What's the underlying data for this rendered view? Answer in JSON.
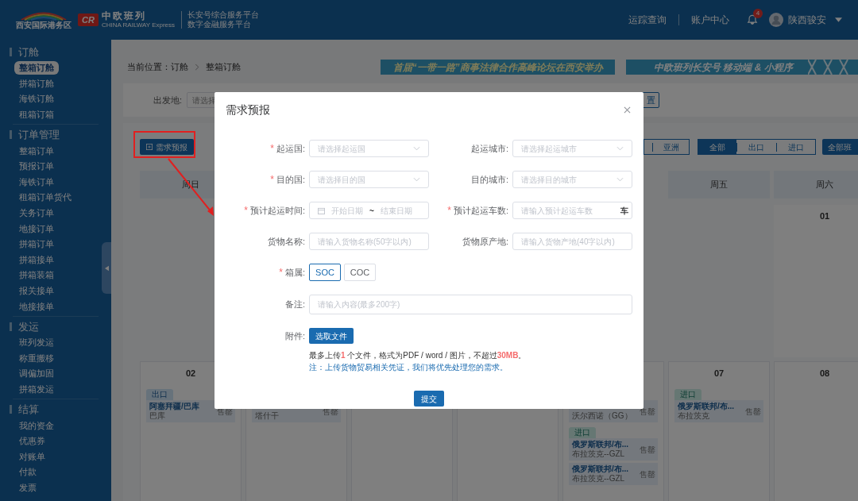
{
  "header": {
    "logo_text": "西安国际港务区",
    "brand_mark": "CR",
    "brand": "中欧班列",
    "brand_sub": "CHINA RAILWAY Express",
    "platform_lines": [
      "长安号综合服务平台",
      "数字金融服务平台"
    ],
    "nav": [
      "运踪查询",
      "账户中心"
    ],
    "notification_count": "4",
    "user": "陕西骏安"
  },
  "sidebar": {
    "groups": [
      {
        "title": "订舱",
        "items": [
          {
            "label": "整箱订舱",
            "selected": true
          },
          {
            "label": "拼箱订舱",
            "selected": false
          },
          {
            "label": "海铁订舱",
            "selected": false
          },
          {
            "label": "租箱订箱",
            "selected": false
          }
        ]
      },
      {
        "title": "订单管理",
        "items": [
          {
            "label": "整箱订单",
            "selected": false
          },
          {
            "label": "预报订单",
            "selected": false
          },
          {
            "label": "海铁订单",
            "selected": false
          },
          {
            "label": "租箱订单货代",
            "selected": false
          },
          {
            "label": "关务订单",
            "selected": false
          },
          {
            "label": "地接订单",
            "selected": false
          },
          {
            "label": "拼箱订单",
            "selected": false
          },
          {
            "label": "拼箱接单",
            "selected": false
          },
          {
            "label": "拼箱装箱",
            "selected": false
          },
          {
            "label": "报关接单",
            "selected": false
          },
          {
            "label": "地接接单",
            "selected": false
          }
        ]
      },
      {
        "title": "发运",
        "items": [
          {
            "label": "班列发运",
            "selected": false
          },
          {
            "label": "称重搬移",
            "selected": false
          },
          {
            "label": "调偏加固",
            "selected": false
          },
          {
            "label": "拼箱发运",
            "selected": false
          }
        ]
      },
      {
        "title": "结算",
        "items": [
          {
            "label": "我的资金",
            "selected": false
          },
          {
            "label": "优惠券",
            "selected": false
          },
          {
            "label": "对账单",
            "selected": false
          },
          {
            "label": "付款",
            "selected": false
          },
          {
            "label": "发票",
            "selected": false
          }
        ]
      }
    ]
  },
  "breadcrumb": {
    "label": "当前位置：",
    "path": [
      "订舱",
      "整箱订舱"
    ]
  },
  "banners": [
    "首届“一带一路”商事法律合作高峰论坛在西安举办",
    "中欧班列长安号 移动端 & 小程序"
  ],
  "filter": {
    "label": "出发地:",
    "placeholder": "请选择",
    "button": "置"
  },
  "toolbar": {
    "forecast_button": "需求预报",
    "region_tabs": [
      {
        "label": "亚洲",
        "selected": false
      }
    ],
    "direction_tabs": [
      {
        "label": "全部",
        "selected": true
      },
      {
        "label": "出口",
        "selected": false
      },
      {
        "label": "进口",
        "selected": false
      }
    ],
    "schedule_button": "全部班"
  },
  "calendar": {
    "columns": [
      {
        "weekday": "周日",
        "week2": {
          "date": "02",
          "groups": [
            {
              "tag": {
                "label": "出口",
                "kind": "export"
              },
              "entries": [
                {
                  "title": "阿塞拜疆/巴库",
                  "subtitle": "巴库",
                  "status": "售罄"
                }
              ]
            }
          ]
        }
      },
      {
        "week2": {
          "groups": [
            {
              "entries": [
                {
                  "subtitle": "塔什干",
                  "status": "售罄"
                }
              ]
            }
          ]
        }
      },
      {},
      {},
      {
        "week2": {
          "groups": [
            {
              "entries": [
                {
                  "subtitle": "沃尔西诺（GG）",
                  "status": "售罄"
                }
              ]
            },
            {
              "tag": {
                "label": "进口",
                "kind": "import"
              },
              "entries": [
                {
                  "title": "俄罗斯联邦/布...",
                  "subtitle": "布拉茨克--GZL",
                  "status": "售罄"
                },
                {
                  "title": "俄罗斯联邦/布...",
                  "subtitle": "布拉茨克--GZL",
                  "status": "售罄"
                }
              ]
            }
          ]
        }
      },
      {
        "weekday": "周五",
        "week2": {
          "date": "07",
          "groups": [
            {
              "tag": {
                "label": "进口",
                "kind": "import"
              },
              "entries": [
                {
                  "title": "俄罗斯联邦/布...",
                  "subtitle": "布拉茨克",
                  "status": "售罄"
                }
              ]
            }
          ]
        }
      },
      {
        "weekday": "周六",
        "week1": {
          "date": "01"
        },
        "week2": {
          "date": "08"
        }
      }
    ]
  },
  "modal": {
    "title": "需求预报",
    "required_mark": "*",
    "fields": [
      {
        "kind": "select",
        "label": "起运国:",
        "required": true,
        "placeholder": "请选择起运国"
      },
      {
        "kind": "select",
        "label": "起运城市:",
        "required": false,
        "placeholder": "请选择起运城市"
      },
      {
        "kind": "select",
        "label": "目的国:",
        "required": true,
        "placeholder": "请选择目的国"
      },
      {
        "kind": "select",
        "label": "目的城市:",
        "required": false,
        "placeholder": "请选择目的城市"
      },
      {
        "kind": "daterange",
        "label": "预计起运时间:",
        "required": true,
        "start_placeholder": "开始日期",
        "separator": "~",
        "end_placeholder": "结束日期"
      },
      {
        "kind": "number",
        "label": "预计起运车数:",
        "required": true,
        "placeholder": "请输入预计起运车数",
        "suffix": "车"
      },
      {
        "kind": "text",
        "label": "货物名称:",
        "required": false,
        "placeholder": "请输入货物名称(50字以内)"
      },
      {
        "kind": "text",
        "label": "货物原产地:",
        "required": false,
        "placeholder": "请输入货物产地(40字以内)"
      },
      {
        "kind": "choice",
        "label": "箱属:",
        "required": true,
        "options": [
          {
            "label": "SOC",
            "selected": true
          },
          {
            "label": "COC",
            "selected": false
          }
        ]
      },
      {
        "kind": "textarea",
        "label": "备注:",
        "required": false,
        "placeholder": "请输入内容(最多200字)"
      },
      {
        "kind": "upload",
        "label": "附件:",
        "required": false,
        "button": "选取文件",
        "hint": "最多上传**1** 个文件，格式为PDF / word / 图片，不超过**30MB**。",
        "note": "注：上传货物贸易相关凭证，我们将优先处理您的需求。"
      }
    ],
    "submit": "提交"
  }
}
